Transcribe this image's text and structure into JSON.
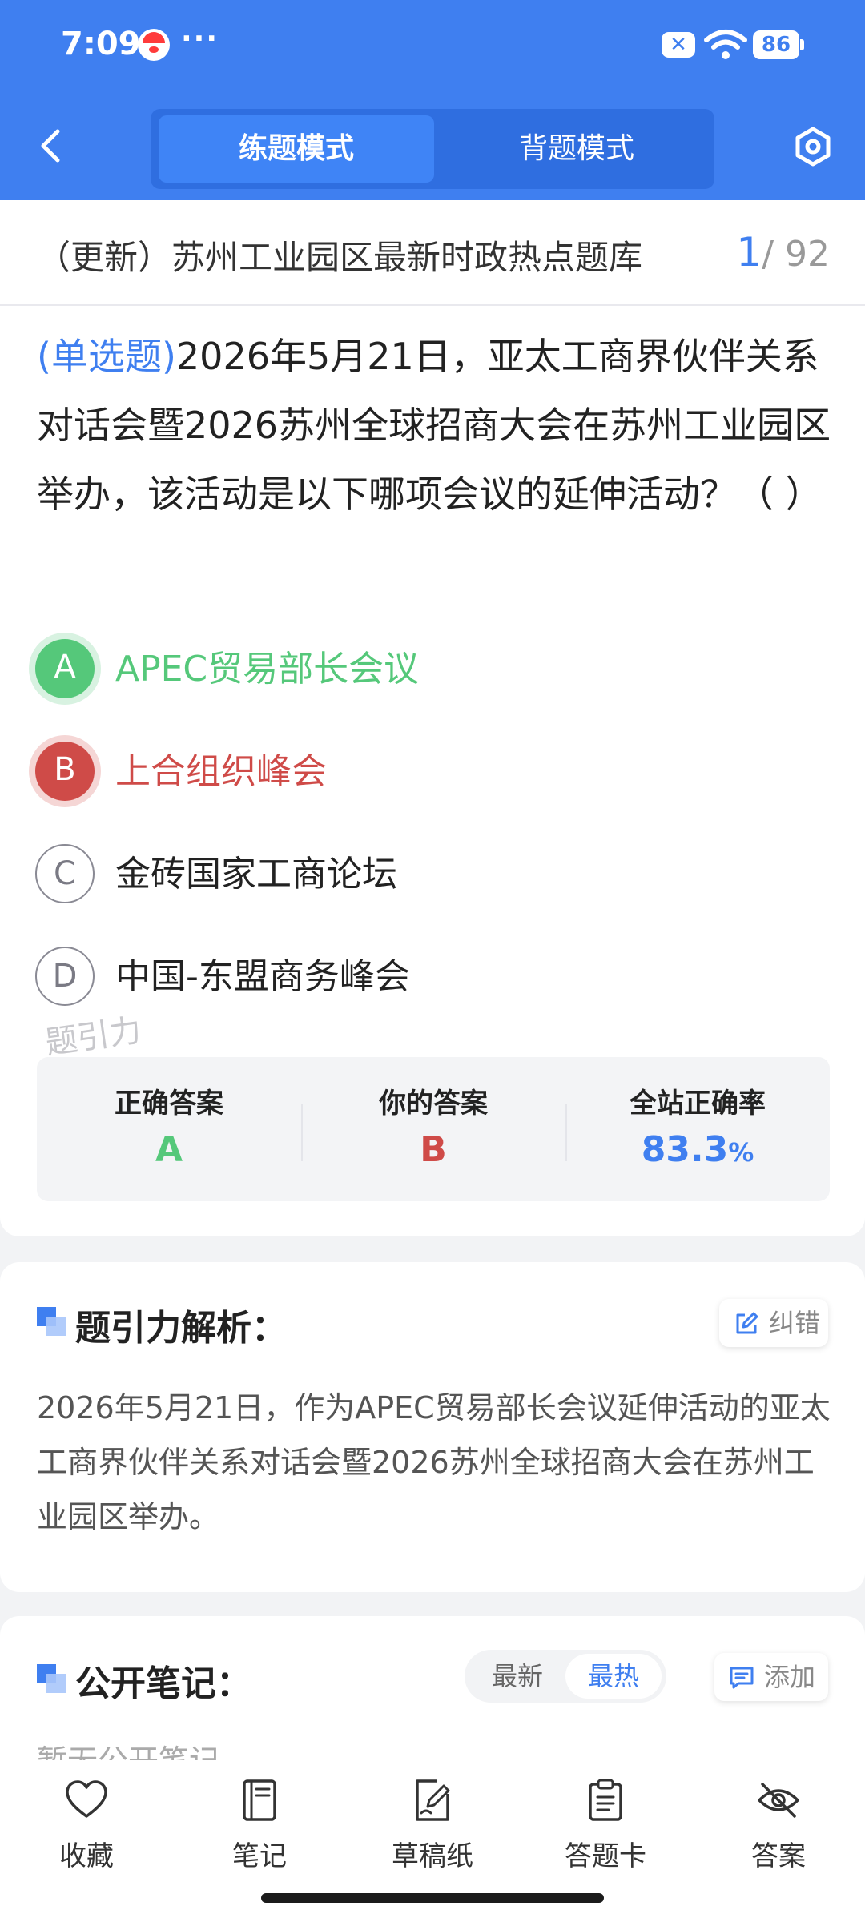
{
  "status_bar": {
    "time": "7:09",
    "dots": "···",
    "sim": "✕",
    "battery": "86"
  },
  "header": {
    "tabs": [
      {
        "label": "练题模式",
        "active": true
      },
      {
        "label": "背题模式",
        "active": false
      }
    ]
  },
  "bank": {
    "title": "（更新）苏州工业园区最新时政热点题库",
    "current": "1",
    "total": "/ 92"
  },
  "question": {
    "type": "(单选题)",
    "text": "2026年5月21日，亚太工商界伙伴关系对话会暨2026苏州全球招商大会在苏州工业园区举办，该活动是以下哪项会议的延伸活动？（        ）",
    "options": [
      {
        "letter": "A",
        "text": "APEC贸易部长会议",
        "state": "correct"
      },
      {
        "letter": "B",
        "text": "上合组织峰会",
        "state": "wrong"
      },
      {
        "letter": "C",
        "text": "金砖国家工商论坛",
        "state": "plain"
      },
      {
        "letter": "D",
        "text": "中国-东盟商务峰会",
        "state": "plain"
      }
    ],
    "watermark": "题引力"
  },
  "answers": {
    "correct_label": "正确答案",
    "correct_value": "A",
    "yours_label": "你的答案",
    "yours_value": "B",
    "rate_label": "全站正确率",
    "rate_value": "83.3",
    "rate_unit": "%"
  },
  "analysis": {
    "title": "题引力解析：",
    "correct_btn": "纠错",
    "text": "2026年5月21日，作为APEC贸易部长会议延伸活动的亚太工商界伙伴关系对话会暨2026苏州全球招商大会在苏州工业园区举办。"
  },
  "notes": {
    "title": "公开笔记：",
    "sort_newest": "最新",
    "sort_hottest": "最热",
    "add_btn": "添加",
    "empty": "暂无公开笔记"
  },
  "bottom_bar": [
    {
      "label": "收藏",
      "icon": "heart-icon"
    },
    {
      "label": "笔记",
      "icon": "notebook-icon"
    },
    {
      "label": "草稿纸",
      "icon": "draft-pen-icon"
    },
    {
      "label": "答题卡",
      "icon": "clipboard-icon"
    },
    {
      "label": "答案",
      "icon": "eye-off-icon"
    }
  ],
  "colors": {
    "primary": "#3f7ff0",
    "correct": "#55c87a",
    "wrong": "#cf4b48"
  }
}
